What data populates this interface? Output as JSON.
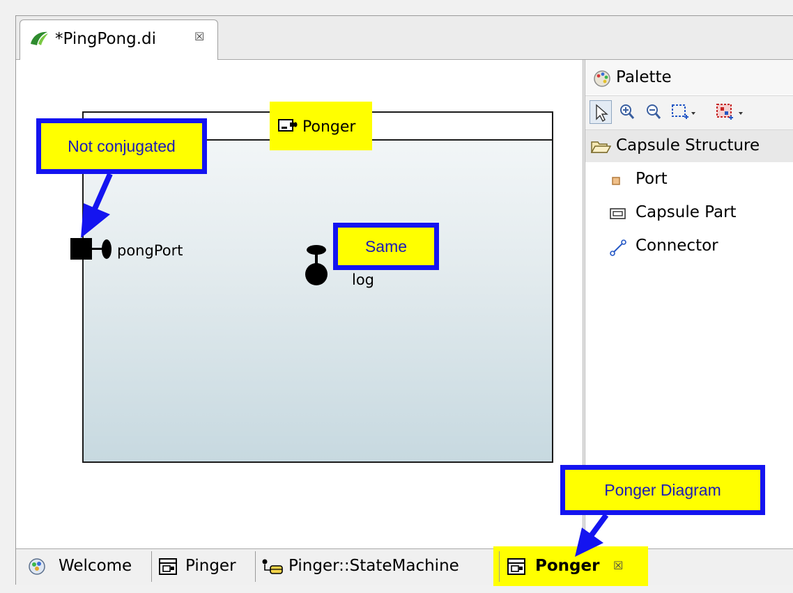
{
  "editor": {
    "tab_label": "*PingPong.di",
    "tab_close": "☒"
  },
  "diagram": {
    "capsule_title": "Ponger",
    "ports": [
      {
        "label": "pongPort"
      },
      {
        "label": "log"
      }
    ]
  },
  "callouts": {
    "not_conjugated": "Not conjugated",
    "same": "Same",
    "ponger_diagram": "Ponger Diagram"
  },
  "palette": {
    "title": "Palette",
    "drawer": "Capsule Structure",
    "items": [
      "Port",
      "Capsule Part",
      "Connector"
    ]
  },
  "bottom_tabs": [
    {
      "label": "Welcome"
    },
    {
      "label": "Pinger"
    },
    {
      "label": "Pinger::StateMachine"
    },
    {
      "label": "Ponger",
      "close": "☒"
    }
  ],
  "colors": {
    "highlight": "#ffff00",
    "callout_border": "#1414f0",
    "callout_text": "#1b1bb8"
  }
}
